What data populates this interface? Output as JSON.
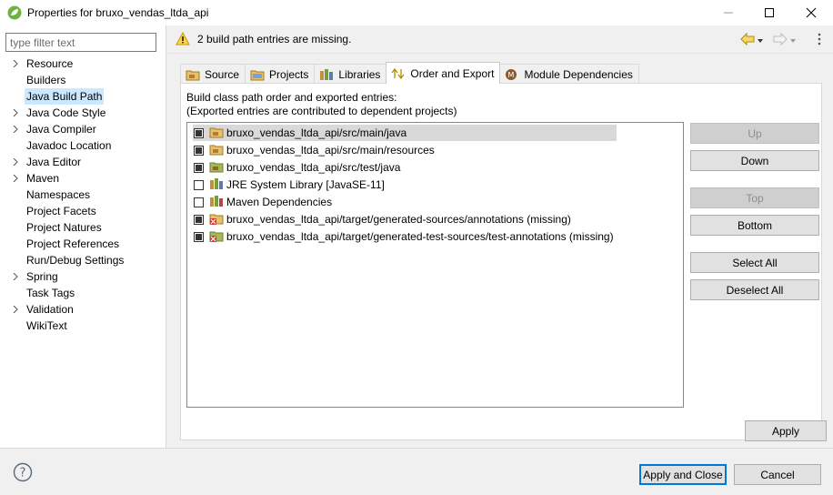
{
  "window": {
    "title": "Properties for bruxo_vendas_ltda_api",
    "app_icon": "spring-leaf-icon"
  },
  "filter": {
    "placeholder": "type filter text",
    "value": ""
  },
  "tree": {
    "items": [
      {
        "label": "Resource",
        "expandable": true,
        "selected": false
      },
      {
        "label": "Builders",
        "expandable": false,
        "selected": false
      },
      {
        "label": "Java Build Path",
        "expandable": false,
        "selected": true
      },
      {
        "label": "Java Code Style",
        "expandable": true,
        "selected": false
      },
      {
        "label": "Java Compiler",
        "expandable": true,
        "selected": false
      },
      {
        "label": "Javadoc Location",
        "expandable": false,
        "selected": false
      },
      {
        "label": "Java Editor",
        "expandable": true,
        "selected": false
      },
      {
        "label": "Maven",
        "expandable": true,
        "selected": false
      },
      {
        "label": "Namespaces",
        "expandable": false,
        "selected": false
      },
      {
        "label": "Project Facets",
        "expandable": false,
        "selected": false
      },
      {
        "label": "Project Natures",
        "expandable": false,
        "selected": false
      },
      {
        "label": "Project References",
        "expandable": false,
        "selected": false
      },
      {
        "label": "Run/Debug Settings",
        "expandable": false,
        "selected": false
      },
      {
        "label": "Spring",
        "expandable": true,
        "selected": false
      },
      {
        "label": "Task Tags",
        "expandable": false,
        "selected": false
      },
      {
        "label": "Validation",
        "expandable": true,
        "selected": false
      },
      {
        "label": "WikiText",
        "expandable": false,
        "selected": false
      }
    ]
  },
  "message": {
    "text": "2 build path entries are missing.",
    "icon": "warning-icon"
  },
  "tabs": [
    {
      "label": "Source",
      "icon": "source-folder-icon",
      "active": false
    },
    {
      "label": "Projects",
      "icon": "projects-icon",
      "active": false
    },
    {
      "label": "Libraries",
      "icon": "libraries-icon",
      "active": false
    },
    {
      "label": "Order and Export",
      "icon": "order-export-icon",
      "active": true
    },
    {
      "label": "Module Dependencies",
      "icon": "module-icon",
      "active": false
    }
  ],
  "order_export": {
    "description_line1": "Build class path order and exported entries:",
    "description_line2": "(Exported entries are contributed to dependent projects)",
    "entries": [
      {
        "label": "bruxo_vendas_ltda_api/src/main/java",
        "checked": true,
        "icon": "source-folder-icon",
        "missing": false,
        "selected": true
      },
      {
        "label": "bruxo_vendas_ltda_api/src/main/resources",
        "checked": true,
        "icon": "source-folder-icon",
        "missing": false,
        "selected": false
      },
      {
        "label": "bruxo_vendas_ltda_api/src/test/java",
        "checked": true,
        "icon": "test-folder-icon",
        "missing": false,
        "selected": false
      },
      {
        "label": "JRE System Library [JavaSE-11]",
        "checked": false,
        "icon": "library-icon",
        "missing": false,
        "selected": false
      },
      {
        "label": "Maven Dependencies",
        "checked": false,
        "icon": "library-icon",
        "missing": false,
        "selected": false
      },
      {
        "label": "bruxo_vendas_ltda_api/target/generated-sources/annotations (missing)",
        "checked": true,
        "icon": "missing-folder-icon",
        "missing": true,
        "selected": false
      },
      {
        "label": "bruxo_vendas_ltda_api/target/generated-test-sources/test-annotations (missing)",
        "checked": true,
        "icon": "missing-folder-icon",
        "missing": true,
        "selected": false
      }
    ],
    "buttons": {
      "up": "Up",
      "down": "Down",
      "top": "Top",
      "bottom": "Bottom",
      "select_all": "Select All",
      "deselect_all": "Deselect All"
    }
  },
  "apply_label": "Apply",
  "footer": {
    "apply_close": "Apply and Close",
    "cancel": "Cancel"
  }
}
